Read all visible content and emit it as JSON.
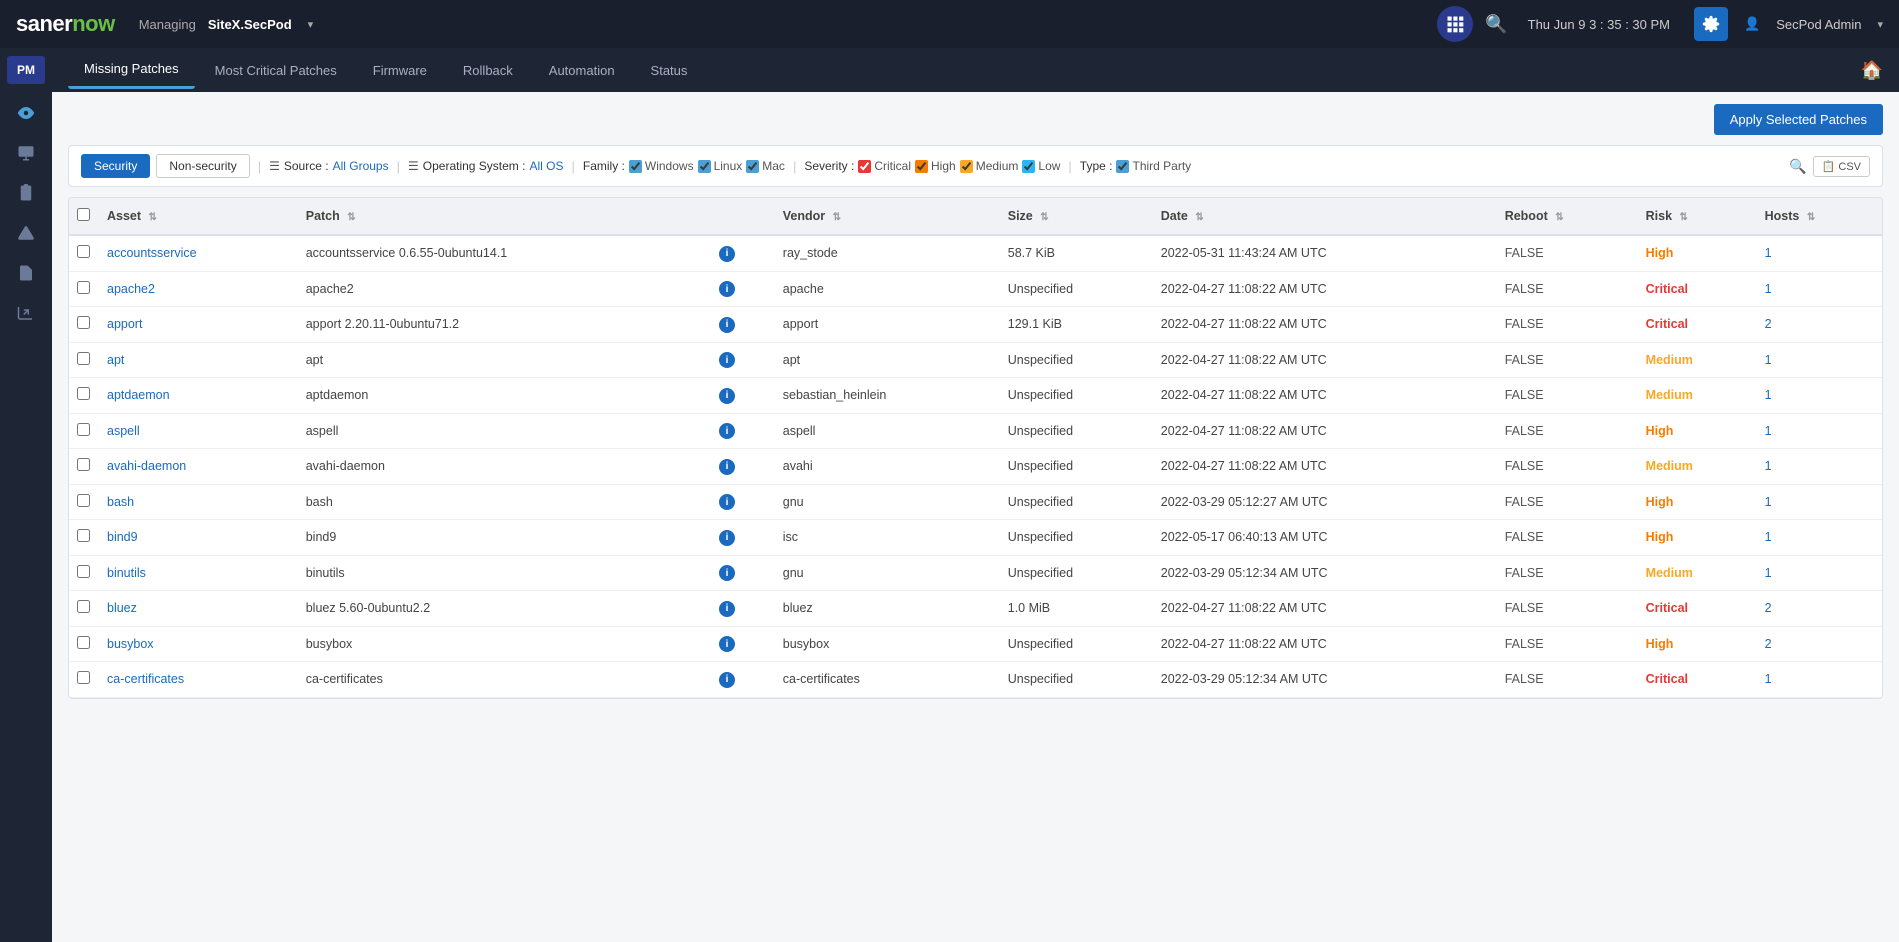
{
  "topbar": {
    "logo_saner": "saner",
    "logo_now": "now",
    "managing_label": "Managing",
    "site_name": "SiteX.SecPod",
    "grid_icon": "grid-icon",
    "datetime": "Thu Jun 9  3 : 35 : 30 PM",
    "settings_icon": "gear-icon",
    "user_label": "SecPod Admin"
  },
  "sidebar": {
    "pm_label": "PM",
    "icons": [
      {
        "name": "eye-icon",
        "symbol": "👁"
      },
      {
        "name": "monitor-icon",
        "symbol": "🖥"
      },
      {
        "name": "document-icon",
        "symbol": "📋"
      },
      {
        "name": "alert-icon",
        "symbol": "⚠"
      },
      {
        "name": "report-icon",
        "symbol": "📄"
      },
      {
        "name": "export-icon",
        "symbol": "↗"
      }
    ]
  },
  "nav": {
    "items": [
      {
        "label": "Missing Patches",
        "active": true
      },
      {
        "label": "Most Critical Patches",
        "active": false
      },
      {
        "label": "Firmware",
        "active": false
      },
      {
        "label": "Rollback",
        "active": false
      },
      {
        "label": "Automation",
        "active": false
      },
      {
        "label": "Status",
        "active": false
      }
    ],
    "home_icon": "🏠"
  },
  "toolbar": {
    "apply_patches_label": "Apply Selected Patches"
  },
  "filters": {
    "security_label": "Security",
    "non_security_label": "Non-security",
    "source_label": "Source :",
    "source_value": "All Groups",
    "os_label": "Operating System :",
    "os_value": "All OS",
    "family_label": "Family :",
    "windows_label": "Windows",
    "linux_label": "Linux",
    "mac_label": "Mac",
    "severity_label": "Severity :",
    "critical_label": "Critical",
    "high_label": "High",
    "medium_label": "Medium",
    "low_label": "Low",
    "type_label": "Type :",
    "third_party_label": "Third Party",
    "csv_label": "CSV"
  },
  "table": {
    "columns": [
      "Asset",
      "Patch",
      "",
      "Vendor",
      "Size",
      "Date",
      "Reboot",
      "Risk",
      "Hosts"
    ],
    "rows": [
      {
        "asset": "accountsservice",
        "patch": "accountsservice 0.6.55-0ubuntu14.1",
        "vendor": "ray_stode",
        "size": "58.7 KiB",
        "date": "2022-05-31 11:43:24 AM UTC",
        "reboot": "FALSE",
        "risk": "High",
        "risk_class": "risk-high",
        "hosts": "1"
      },
      {
        "asset": "apache2",
        "patch": "apache2",
        "vendor": "apache",
        "size": "Unspecified",
        "date": "2022-04-27 11:08:22 AM UTC",
        "reboot": "FALSE",
        "risk": "Critical",
        "risk_class": "risk-critical",
        "hosts": "1"
      },
      {
        "asset": "apport",
        "patch": "apport 2.20.11-0ubuntu71.2",
        "vendor": "apport",
        "size": "129.1 KiB",
        "date": "2022-04-27 11:08:22 AM UTC",
        "reboot": "FALSE",
        "risk": "Critical",
        "risk_class": "risk-critical",
        "hosts": "2"
      },
      {
        "asset": "apt",
        "patch": "apt",
        "vendor": "apt",
        "size": "Unspecified",
        "date": "2022-04-27 11:08:22 AM UTC",
        "reboot": "FALSE",
        "risk": "Medium",
        "risk_class": "risk-medium",
        "hosts": "1"
      },
      {
        "asset": "aptdaemon",
        "patch": "aptdaemon",
        "vendor": "sebastian_heinlein",
        "size": "Unspecified",
        "date": "2022-04-27 11:08:22 AM UTC",
        "reboot": "FALSE",
        "risk": "Medium",
        "risk_class": "risk-medium",
        "hosts": "1"
      },
      {
        "asset": "aspell",
        "patch": "aspell",
        "vendor": "aspell",
        "size": "Unspecified",
        "date": "2022-04-27 11:08:22 AM UTC",
        "reboot": "FALSE",
        "risk": "High",
        "risk_class": "risk-high",
        "hosts": "1"
      },
      {
        "asset": "avahi-daemon",
        "patch": "avahi-daemon",
        "vendor": "avahi",
        "size": "Unspecified",
        "date": "2022-04-27 11:08:22 AM UTC",
        "reboot": "FALSE",
        "risk": "Medium",
        "risk_class": "risk-medium",
        "hosts": "1"
      },
      {
        "asset": "bash",
        "patch": "bash",
        "vendor": "gnu",
        "size": "Unspecified",
        "date": "2022-03-29 05:12:27 AM UTC",
        "reboot": "FALSE",
        "risk": "High",
        "risk_class": "risk-high",
        "hosts": "1"
      },
      {
        "asset": "bind9",
        "patch": "bind9",
        "vendor": "isc",
        "size": "Unspecified",
        "date": "2022-05-17 06:40:13 AM UTC",
        "reboot": "FALSE",
        "risk": "High",
        "risk_class": "risk-high",
        "hosts": "1"
      },
      {
        "asset": "binutils",
        "patch": "binutils",
        "vendor": "gnu",
        "size": "Unspecified",
        "date": "2022-03-29 05:12:34 AM UTC",
        "reboot": "FALSE",
        "risk": "Medium",
        "risk_class": "risk-medium",
        "hosts": "1"
      },
      {
        "asset": "bluez",
        "patch": "bluez 5.60-0ubuntu2.2",
        "vendor": "bluez",
        "size": "1.0 MiB",
        "date": "2022-04-27 11:08:22 AM UTC",
        "reboot": "FALSE",
        "risk": "Critical",
        "risk_class": "risk-critical",
        "hosts": "2"
      },
      {
        "asset": "busybox",
        "patch": "busybox",
        "vendor": "busybox",
        "size": "Unspecified",
        "date": "2022-04-27 11:08:22 AM UTC",
        "reboot": "FALSE",
        "risk": "High",
        "risk_class": "risk-high",
        "hosts": "2"
      },
      {
        "asset": "ca-certificates",
        "patch": "ca-certificates",
        "vendor": "ca-certificates",
        "size": "Unspecified",
        "date": "2022-03-29 05:12:34 AM UTC",
        "reboot": "FALSE",
        "risk": "Critical",
        "risk_class": "risk-critical",
        "hosts": "1"
      }
    ]
  }
}
